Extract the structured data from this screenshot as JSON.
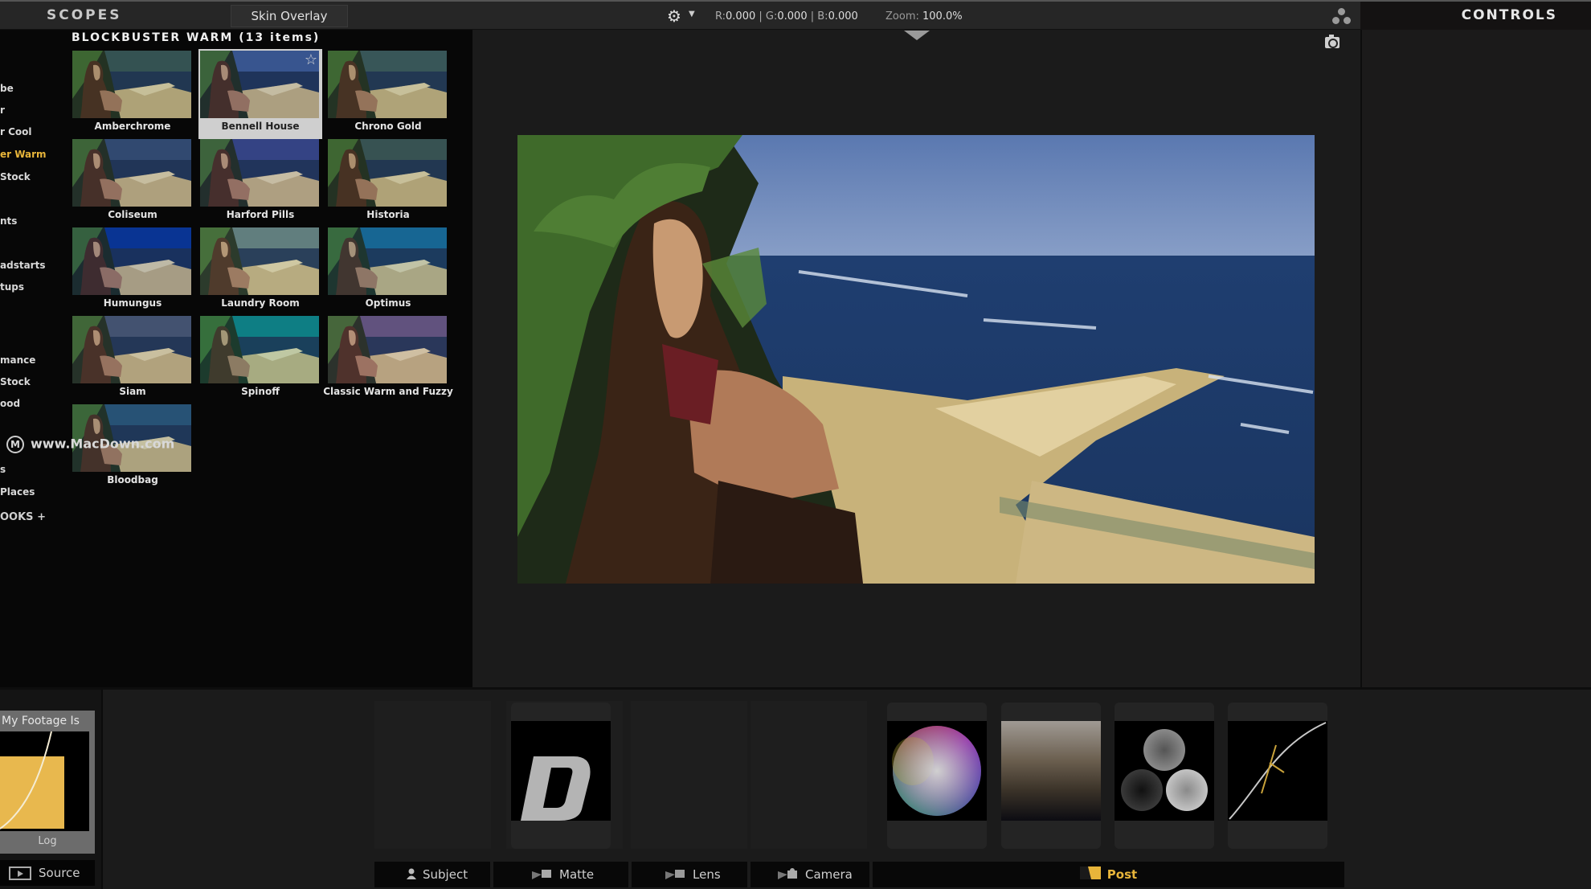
{
  "topbar": {
    "scopes_title": "SCOPES",
    "skin_overlay_label": "Skin Overlay",
    "settings_icon": "gear-icon",
    "readout": {
      "r_label": "R:",
      "r": "0.000",
      "g_label": "G:",
      "g": "0.000",
      "b_label": "B:",
      "b": "0.000",
      "sep": "|"
    },
    "zoom_label": "Zoom:",
    "zoom_value": "100.0%",
    "nodes_icon": "three-circles-icon"
  },
  "controls": {
    "title": "CONTROLS"
  },
  "library": {
    "title": "BLOCKBUSTER WARM (13 items)",
    "categories": [
      {
        "label": "be",
        "active": false
      },
      {
        "label": "r",
        "active": false
      },
      {
        "label": "r Cool",
        "active": false
      },
      {
        "label": "er Warm",
        "active": true
      },
      {
        "label": "Stock",
        "active": false
      },
      {
        "label": "nts",
        "active": false
      },
      {
        "label": "adstarts",
        "active": false
      },
      {
        "label": "tups",
        "active": false
      },
      {
        "label": "mance",
        "active": false
      },
      {
        "label": "Stock",
        "active": false
      },
      {
        "label": "ood",
        "active": false
      },
      {
        "label": "s",
        "active": false
      },
      {
        "label": "Places",
        "active": false
      }
    ],
    "add_looks_label": "OOKS +",
    "looks": [
      {
        "name": "Amberchrome",
        "tint": "#3a5a5a",
        "selected": false
      },
      {
        "name": "Bennell House",
        "tint": "#2a4a8a",
        "selected": true,
        "favorite": true
      },
      {
        "name": "Chrono Gold",
        "tint": "#3e5e60",
        "selected": false
      },
      {
        "name": "Coliseum",
        "tint": "#35507a",
        "selected": false
      },
      {
        "name": "Harford Pills",
        "tint": "#3a4a90",
        "selected": false
      },
      {
        "name": "Historia",
        "tint": "#3c5a5a",
        "selected": false
      },
      {
        "name": "Humungus",
        "tint": "#0a3aa0",
        "selected": false
      },
      {
        "name": "Laundry Room",
        "tint": "#6a8a8a",
        "selected": false
      },
      {
        "name": "Optimus",
        "tint": "#1a70a0",
        "selected": false
      },
      {
        "name": "Siam",
        "tint": "#4a5a7a",
        "selected": false
      },
      {
        "name": "Spinoff",
        "tint": "#0f8a90",
        "selected": false
      },
      {
        "name": "Classic Warm and Fuzzy",
        "tint": "#6a5a8a",
        "selected": false
      },
      {
        "name": "Bloodbag",
        "tint": "#2a5a80",
        "selected": false
      }
    ],
    "watermark": "www.MacDown.com"
  },
  "viewer": {
    "snapshot_icon": "camera-icon",
    "collapse_icon": "triangle-down-icon"
  },
  "source": {
    "footage_title": "My Footage Is",
    "footage_value": "Log",
    "tab_label": "Source"
  },
  "tools": [
    {
      "name": "D",
      "label": ""
    },
    {
      "name": "color-wheel",
      "label": ""
    },
    {
      "name": "gradient",
      "label": ""
    },
    {
      "name": "three-way",
      "label": ""
    },
    {
      "name": "curves",
      "label": ""
    }
  ],
  "tabs": [
    {
      "label": "Subject",
      "icon": "person-icon"
    },
    {
      "label": "Matte",
      "icon": "matte-icon"
    },
    {
      "label": "Lens",
      "icon": "lens-icon"
    },
    {
      "label": "Camera",
      "icon": "camera-rig-icon"
    },
    {
      "label": "Post",
      "icon": "post-icon",
      "active": true
    }
  ],
  "colors": {
    "accent": "#e8b53a",
    "background": "#1b1b1b",
    "panel": "#070707"
  }
}
